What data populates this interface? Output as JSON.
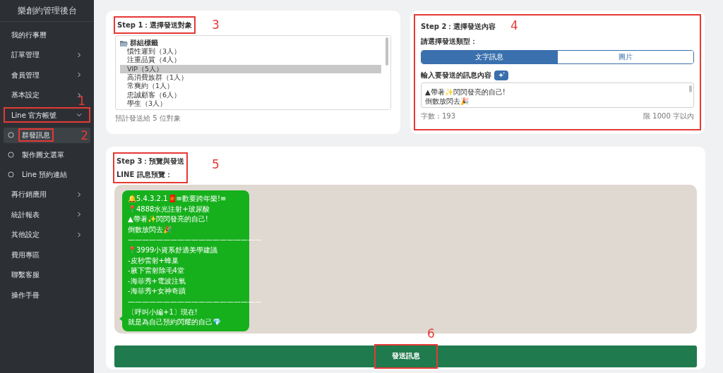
{
  "sidebar": {
    "title": "樂創約管理後台",
    "items": [
      {
        "label": "我的行事曆",
        "kind": "link"
      },
      {
        "label": "訂單管理",
        "kind": "group",
        "expanded": false
      },
      {
        "label": "會員管理",
        "kind": "group",
        "expanded": false
      },
      {
        "label": "基本設定",
        "kind": "group",
        "expanded": false
      },
      {
        "label": "Line 官方帳號",
        "kind": "group",
        "expanded": true,
        "annotation": "1",
        "children": [
          {
            "label": "群發訊息",
            "selected": true,
            "annotation": "2"
          },
          {
            "label": "製作圖文選單",
            "selected": false
          },
          {
            "label": "Line 預約連結",
            "selected": false
          }
        ]
      },
      {
        "label": "再行銷應用",
        "kind": "group",
        "expanded": false
      },
      {
        "label": "統計報表",
        "kind": "group",
        "expanded": false
      },
      {
        "label": "其他設定",
        "kind": "group",
        "expanded": false
      },
      {
        "label": "費用專區",
        "kind": "link"
      },
      {
        "label": "聯繫客服",
        "kind": "link"
      },
      {
        "label": "操作手冊",
        "kind": "link"
      }
    ]
  },
  "step1": {
    "title": "Step 1：選擇發送對象",
    "annotation": "3",
    "group": {
      "label": "群組標籤",
      "children": [
        {
          "label": "慣性遲到（3人）",
          "selected": false
        },
        {
          "label": "注重品質（4人）",
          "selected": false
        },
        {
          "label": "VIP（5人）",
          "selected": true
        },
        {
          "label": "高消費族群（1人）",
          "selected": false
        },
        {
          "label": "常爽約（1人）",
          "selected": false
        },
        {
          "label": "忠誠顧客（6人）",
          "selected": false
        },
        {
          "label": "學生（3人）",
          "selected": false
        }
      ]
    },
    "hint": "預計發送給 5 位對象"
  },
  "step2": {
    "title": "Step 2：選擇發送內容",
    "annotation": "4",
    "type_label": "請選擇發送類型：",
    "types": [
      {
        "label": "文字訊息",
        "selected": true
      },
      {
        "label": "圖片",
        "selected": false
      }
    ],
    "content_label": "輸入要發送的訊息內容",
    "message_lines": [
      "▲帶著✨閃閃發亮的自己!",
      "倒數放閃去🎉"
    ],
    "count": "字數：193",
    "limit": "限 1000 字以內"
  },
  "step3": {
    "title": "Step 3：預覽與發送",
    "subtitle": "LINE 訊息預覽：",
    "annotation": "5",
    "preview_lines": [
      "🔔5.4.3.2.1🧧≡歡要跨年樂!≡",
      "📍4888水光注射+玻尿酸",
      "▲帶著✨閃閃發亮的自己!",
      "倒數放閃去🎉",
      "———————————————————",
      "📍3999小資系舒適美學建議",
      "-皮秒雷射+蜂巢",
      "-腋下雷射除毛4堂",
      "-海菲秀+電波注氧",
      "-海菲秀+女神奇蹟",
      "———————————————————",
      "〔呼叫小編+1〕現在!",
      "就是為自己預約閃耀的自己💎"
    ],
    "send": {
      "label": "發送訊息",
      "annotation": "6"
    }
  }
}
